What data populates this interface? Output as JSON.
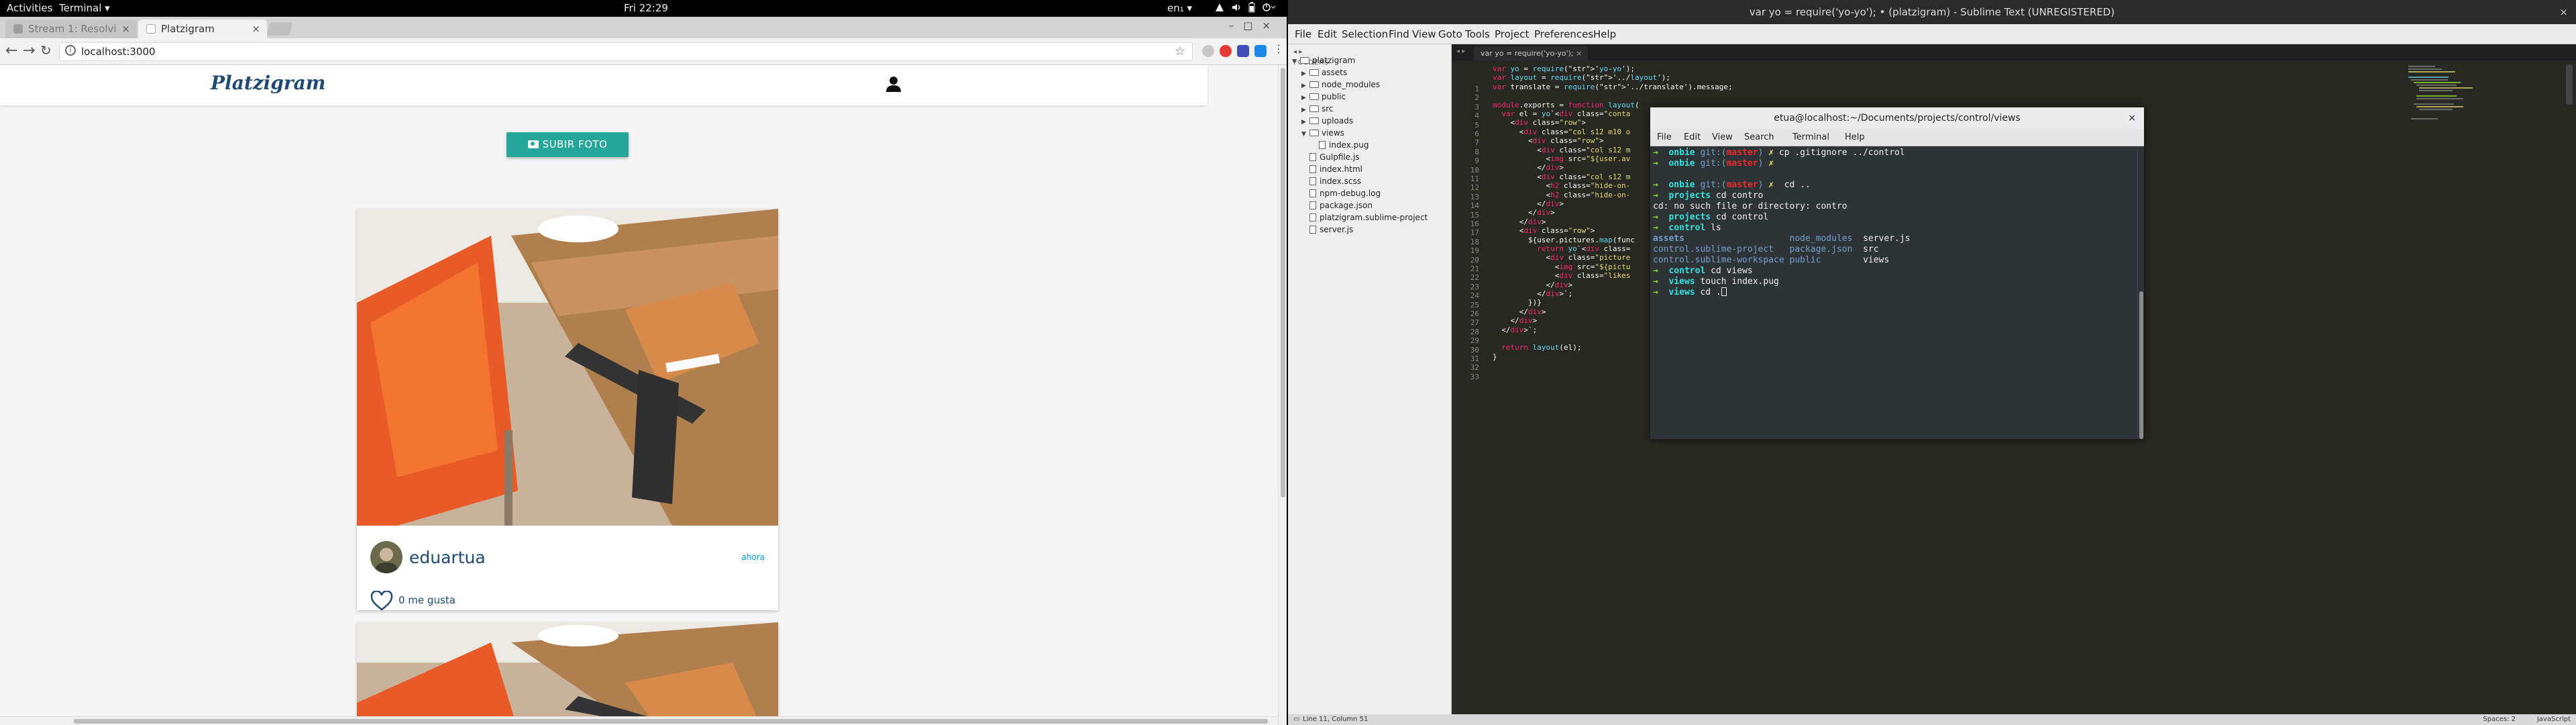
{
  "topbar": {
    "activities": "Activities",
    "app_menu": "Terminal ▾",
    "clock": "Fri 22:29",
    "keyboard_layout": "en₁ ▾",
    "tray_icons": [
      "network-icon",
      "volume-icon",
      "battery-icon",
      "power-icon"
    ]
  },
  "browser": {
    "tabs": [
      {
        "title": "Stream 1: Resolvi",
        "active": false
      },
      {
        "title": "Platzigram",
        "active": true
      }
    ],
    "url": "localhost:3000",
    "window_controls": [
      "minimize",
      "maximize",
      "close"
    ]
  },
  "platzigram": {
    "brand": "Platzigram",
    "upload_label": "SUBIR FOTO",
    "posts": [
      {
        "username": "eduartua",
        "time": "ahora",
        "likes": "0 me gusta"
      },
      {
        "username": "",
        "time": "",
        "likes": ""
      }
    ]
  },
  "sublime": {
    "window_title": "var yo = require('yo-yo'); • (platzigram) - Sublime Text (UNREGISTERED)",
    "menu": [
      "File",
      "Edit",
      "Selection",
      "Find",
      "View",
      "Goto",
      "Tools",
      "Project",
      "Preferences",
      "Help"
    ],
    "folders_header": "FOLDERS",
    "tree": [
      {
        "name": "platzigram",
        "type": "folder",
        "depth": 0,
        "open": true
      },
      {
        "name": "assets",
        "type": "folder",
        "depth": 1,
        "open": false
      },
      {
        "name": "node_modules",
        "type": "folder",
        "depth": 1,
        "open": false
      },
      {
        "name": "public",
        "type": "folder",
        "depth": 1,
        "open": false
      },
      {
        "name": "src",
        "type": "folder",
        "depth": 1,
        "open": false
      },
      {
        "name": "uploads",
        "type": "folder",
        "depth": 1,
        "open": false
      },
      {
        "name": "views",
        "type": "folder",
        "depth": 1,
        "open": true
      },
      {
        "name": "index.pug",
        "type": "file",
        "depth": 2
      },
      {
        "name": "Gulpfile.js",
        "type": "file",
        "depth": 1
      },
      {
        "name": "index.html",
        "type": "file",
        "depth": 1
      },
      {
        "name": "index.scss",
        "type": "file",
        "depth": 1
      },
      {
        "name": "npm-debug.log",
        "type": "file",
        "depth": 1
      },
      {
        "name": "package.json",
        "type": "file",
        "depth": 1
      },
      {
        "name": "platzigram.sublime-project",
        "type": "file",
        "depth": 1
      },
      {
        "name": "server.js",
        "type": "file",
        "depth": 1
      }
    ],
    "tab_title": "var yo = require('yo-yo');",
    "code_lines": [
      "var yo = require('yo-yo');",
      "var layout = require('../layout');",
      "var translate = require('../translate').message;",
      "",
      "module.exports = function layout(",
      "  var el = yo`<div class=\"conta",
      "    <div class=\"row\">",
      "      <div class=\"col s12 m10 o",
      "        <div class=\"row\">",
      "          <div class=\"col s12 m",
      "            <img src=\"${user.av",
      "          </div>",
      "          <div class=\"col s12 m",
      "            <h2 class=\"hide-on-",
      "            <h2 class=\"hide-on-",
      "          </div>",
      "        </div>",
      "      </div>",
      "      <div class=\"row\">",
      "        ${user.pictures.map(func",
      "          return yo`<div class=",
      "            <div class=\"picture",
      "              <img src=\"${pictu",
      "              <div class=\"likes",
      "            </div>",
      "          </div>`;",
      "        })}",
      "      </div>",
      "    </div>",
      "  </div>`;",
      "",
      "  return layout(el);",
      "}"
    ],
    "status_left": "Line 11, Column 51",
    "status_spaces": "Spaces: 2",
    "status_syntax": "JavaScript"
  },
  "terminal": {
    "title": "etua@localhost:~/Documents/projects/control/views",
    "menu": [
      "File",
      "Edit",
      "View",
      "Search",
      "Terminal",
      "Help"
    ],
    "lines": [
      {
        "prompt": "→  ",
        "dir": "onbie",
        "git": " git:(",
        "branch": "master",
        "end": ") ✗ ",
        "cmd": "cp .gitignore ../control"
      },
      {
        "prompt": "→  ",
        "dir": "onbie",
        "git": " git:(",
        "branch": "master",
        "end": ") ✗ ",
        "cmd": ""
      },
      {
        "prompt": "",
        "dir": "",
        "git": "",
        "branch": "",
        "end": "",
        "cmd": ""
      },
      {
        "prompt": "→  ",
        "dir": "onbie",
        "git": " git:(",
        "branch": "master",
        "end": ") ✗ ",
        "cmd": " cd .."
      },
      {
        "prompt": "→  ",
        "dir": "projects",
        "git": "",
        "branch": "",
        "end": " ",
        "cmd": "cd contro"
      },
      {
        "prompt": "",
        "dir": "",
        "git": "",
        "branch": "",
        "end": "",
        "cmd": "cd: no such file or directory: contro"
      },
      {
        "prompt": "→  ",
        "dir": "projects",
        "git": "",
        "branch": "",
        "end": " ",
        "cmd": "cd control"
      },
      {
        "prompt": "→  ",
        "dir": "control",
        "git": "",
        "branch": "",
        "end": " ",
        "cmd": "ls"
      }
    ],
    "ls_output": [
      [
        "assets",
        "node_modules",
        "server.js"
      ],
      [
        "control.sublime-project",
        "package.json",
        "src"
      ],
      [
        "control.sublime-workspace",
        "public",
        "views"
      ]
    ],
    "after_lines": [
      {
        "prompt": "→  ",
        "dir": "control",
        "cmd": "cd views"
      },
      {
        "prompt": "→  ",
        "dir": "views",
        "cmd": "touch index.pug"
      },
      {
        "prompt": "→  ",
        "dir": "views",
        "cmd": "cd ."
      }
    ]
  }
}
